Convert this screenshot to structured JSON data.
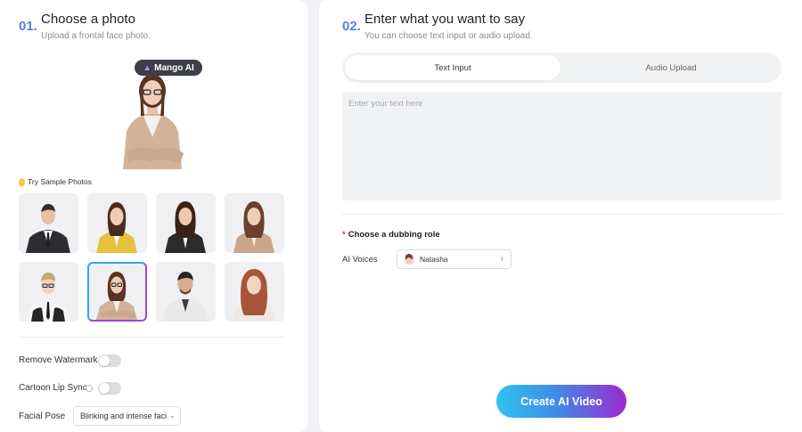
{
  "colors": {
    "accent_blue": "#5b7fe0",
    "button_gradient_start": "#2fc3f0",
    "button_gradient_end": "#9b2bcf",
    "required_star": "#e0403e",
    "page_bg": "#f1f2f5"
  },
  "step1": {
    "number": "01.",
    "title": "Choose a photo",
    "subtitle": "Upload a frontal face photo.",
    "badge": "Mango AI",
    "try_label": "Try Sample Photos",
    "samples": [
      {
        "icon": "man-suit-portrait",
        "selected": false
      },
      {
        "icon": "woman-yellow-jacket-portrait",
        "selected": false
      },
      {
        "icon": "woman-black-blazer-portrait",
        "selected": false
      },
      {
        "icon": "woman-beige-blazer-portrait",
        "selected": false
      },
      {
        "icon": "woman-glasses-tie-portrait",
        "selected": false
      },
      {
        "icon": "woman-beige-blazer-glasses-portrait",
        "selected": true
      },
      {
        "icon": "man-white-suit-portrait",
        "selected": false
      },
      {
        "icon": "woman-redhead-portrait",
        "selected": false
      }
    ],
    "options": {
      "remove_watermark": "Remove Watermark",
      "remove_watermark_on": false,
      "cartoon_lip_sync": "Cartoon Lip Sync",
      "cartoon_lip_sync_on": false,
      "facial_pose_label": "Facial Pose",
      "facial_pose_value": "Blinking and intense facial"
    }
  },
  "step2": {
    "number": "02.",
    "title": "Enter what you want to say",
    "subtitle": "You can choose text input or audio upload.",
    "tabs": [
      "Text Input",
      "Audio Upload"
    ],
    "active_tab": "Text Input",
    "text_placeholder": "Enter your text here",
    "dubbing_title": "Choose a dubbing role",
    "voices_label": "AI Voices",
    "voice_name": "Natasha",
    "create_button": "Create AI Video"
  }
}
